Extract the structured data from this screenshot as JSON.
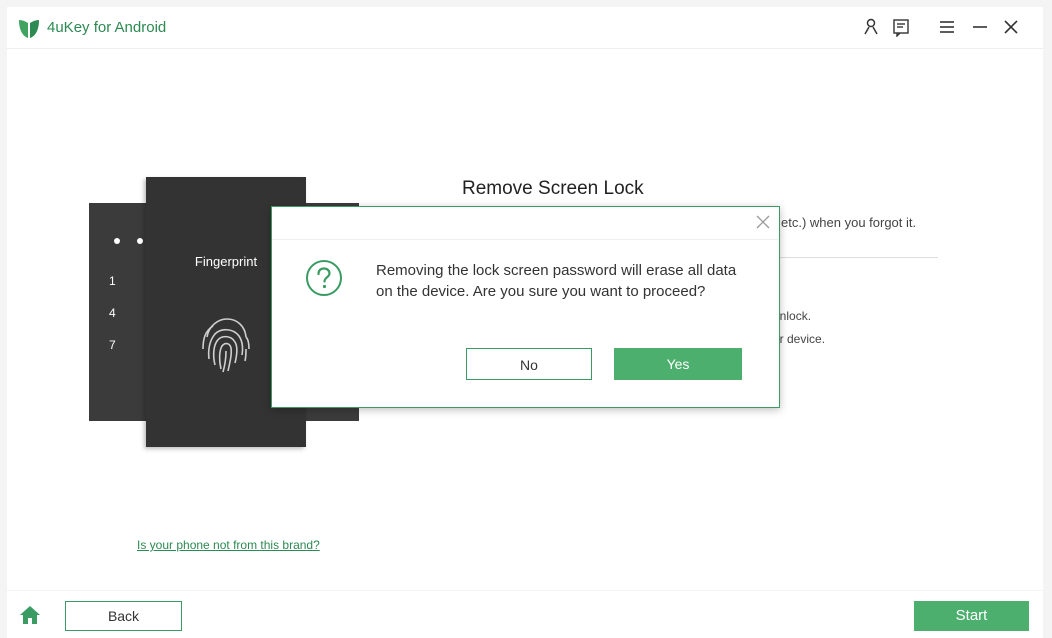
{
  "titlebar": {
    "app_title": "4uKey for Android",
    "icons": [
      "user-icon",
      "feedback-icon",
      "menu-icon",
      "minimize-icon",
      "close-icon"
    ]
  },
  "illustration": {
    "fingerprint_label": "Fingerprint",
    "keypad_numbers": [
      "1",
      "4",
      "7"
    ]
  },
  "main": {
    "heading": "Remove Screen Lock",
    "line1_partial": "etc.) when you forgot it.",
    "line2_partial": "unlock.",
    "line3_partial": "ur device.",
    "brand_link": "Is your phone not from this brand?"
  },
  "dialog": {
    "message": "Removing the lock screen password will erase all data on the device. Are you sure you want to proceed?",
    "no_label": "No",
    "yes_label": "Yes"
  },
  "footer": {
    "back_label": "Back",
    "start_label": "Start"
  },
  "colors": {
    "accent": "#4caf6e",
    "brand_text": "#2c8a52",
    "phone": "#333333"
  }
}
